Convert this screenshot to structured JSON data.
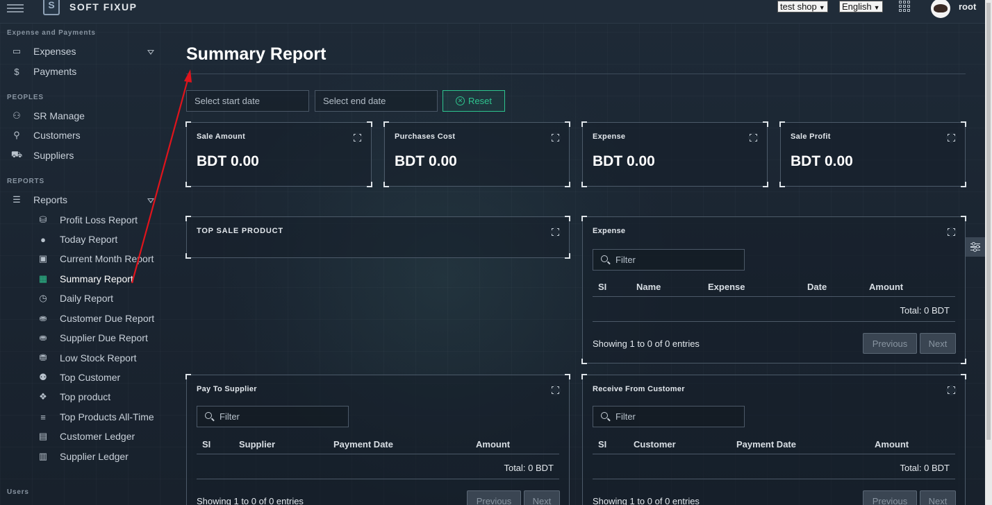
{
  "app": {
    "brand": "SOFT FIXUP",
    "logo_letter": "S"
  },
  "topbar": {
    "shop_select": "test shop",
    "language_select": "English",
    "user": "root"
  },
  "sidebar": {
    "sections": {
      "expense_payments": "Expense and Payments",
      "peoples": "PEOPLES",
      "reports": "REPORTS",
      "users": "Users"
    },
    "items": {
      "expenses": "Expenses",
      "payments": "Payments",
      "sr_manage": "SR Manage",
      "customers": "Customers",
      "suppliers": "Suppliers",
      "reports": "Reports"
    },
    "report_items": [
      "Profit Loss Report",
      "Today Report",
      "Current Month Report",
      "Summary Report",
      "Daily Report",
      "Customer Due Report",
      "Supplier Due Report",
      "Low Stock Report",
      "Top Customer",
      "Top product",
      "Top Products All-Time",
      "Customer Ledger",
      "Supplier Ledger"
    ],
    "active_item": "Summary Report"
  },
  "main": {
    "title": "Summary Report",
    "start_date_placeholder": "Select start date",
    "end_date_placeholder": "Select end date",
    "reset_label": "Reset",
    "stats": [
      {
        "label": "Sale Amount",
        "value": "BDT 0.00"
      },
      {
        "label": "Purchases Cost",
        "value": "BDT 0.00"
      },
      {
        "label": "Expense",
        "value": "BDT 0.00"
      },
      {
        "label": "Sale Profit",
        "value": "BDT 0.00"
      }
    ],
    "top_sale_product": {
      "title": "TOP SALE PRODUCT"
    },
    "expense_table": {
      "title": "Expense",
      "filter_placeholder": "Filter",
      "columns": [
        "SI",
        "Name",
        "Expense",
        "Date",
        "Amount"
      ],
      "total": "Total: 0 BDT",
      "showing": "Showing 1 to 0 of 0 entries",
      "previous": "Previous",
      "next": "Next"
    },
    "pay_to_supplier": {
      "title": "Pay To Supplier",
      "filter_placeholder": "Filter",
      "columns": [
        "SI",
        "Supplier",
        "Payment Date",
        "Amount"
      ],
      "total": "Total: 0 BDT",
      "showing": "Showing 1 to 0 of 0 entries",
      "previous": "Previous",
      "next": "Next"
    },
    "receive_from_customer": {
      "title": "Receive From Customer",
      "filter_placeholder": "Filter",
      "columns": [
        "SI",
        "Customer",
        "Payment Date",
        "Amount"
      ],
      "total": "Total: 0 BDT",
      "showing": "Showing 1 to 0 of 0 entries",
      "previous": "Previous",
      "next": "Next"
    }
  },
  "annotation": {
    "color": "#e0141c"
  },
  "colors": {
    "accent": "#2ec58f",
    "background": "#1b2532"
  }
}
